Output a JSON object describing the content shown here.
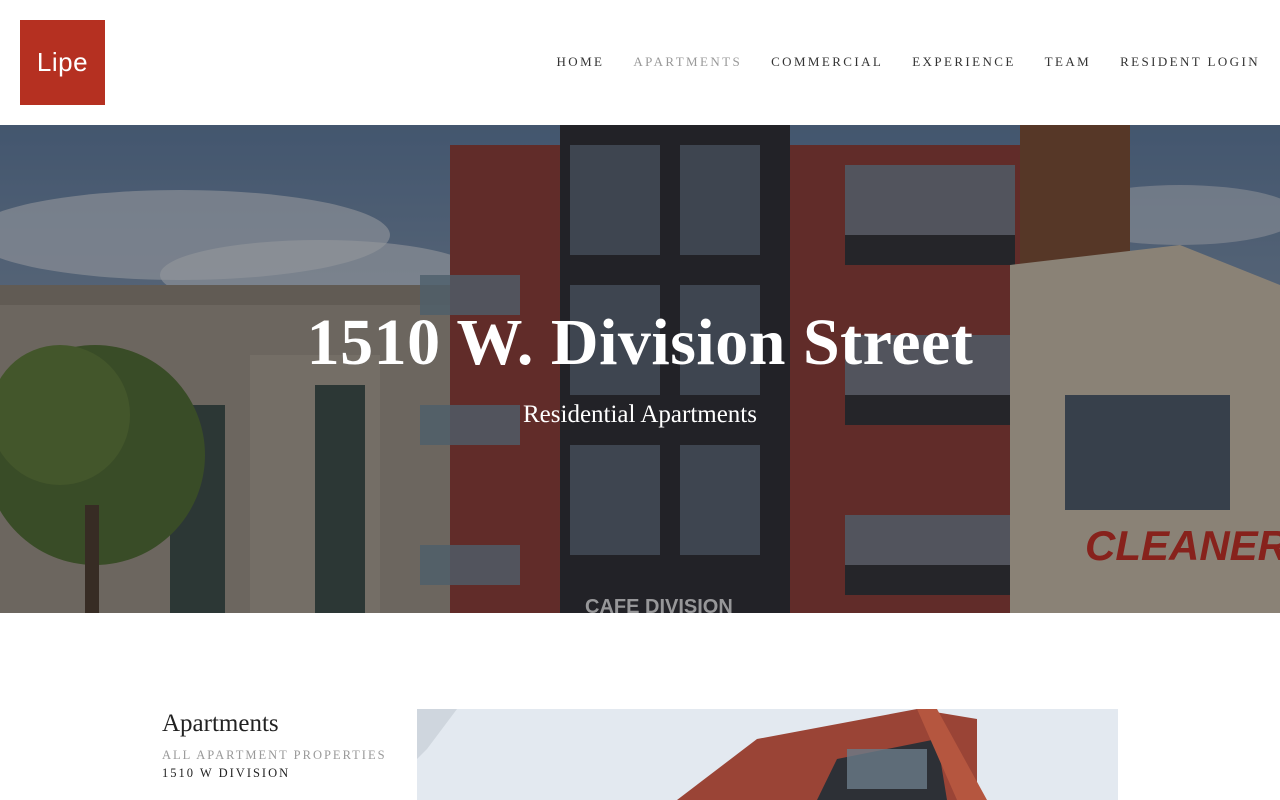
{
  "logo": {
    "text": "Lipe",
    "color": "#b53021"
  },
  "nav": {
    "items": [
      {
        "label": "HOME"
      },
      {
        "label": "APARTMENTS",
        "active": true
      },
      {
        "label": "COMMERCIAL"
      },
      {
        "label": "EXPERIENCE"
      },
      {
        "label": "TEAM"
      },
      {
        "label": "RESIDENT LOGIN"
      }
    ]
  },
  "hero": {
    "title": "1510 W. Division Street",
    "subtitle": "Residential Apartments",
    "cafe_sign": "CAFE DIVISION",
    "cleaners_sign": "CLEANER"
  },
  "sidebar": {
    "heading": "Apartments",
    "links": [
      {
        "label": "ALL APARTMENT PROPERTIES"
      },
      {
        "label": "1510 W DIVISION"
      }
    ]
  }
}
